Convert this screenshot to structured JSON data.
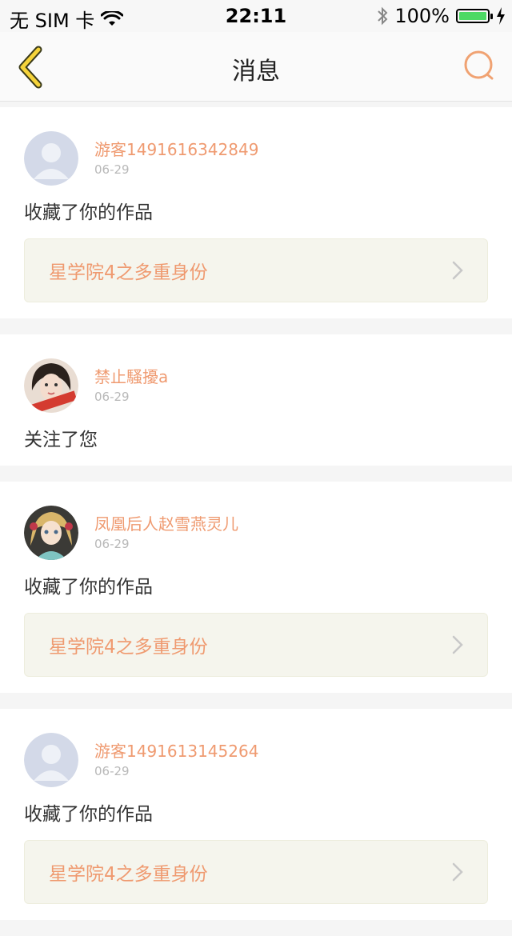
{
  "status_bar": {
    "carrier": "无 SIM 卡",
    "time": "22:11",
    "battery": "100%",
    "icons": [
      "wifi-icon",
      "bluetooth-icon",
      "battery-icon",
      "charging-icon"
    ]
  },
  "nav": {
    "title": "消息",
    "back_icon": "back-chevron-icon",
    "search_icon": "search-icon",
    "accent_color": "#f0a272",
    "back_color": "#f5d33a"
  },
  "messages": [
    {
      "username": "游客1491616342849",
      "date": "06-29",
      "action": "收藏了你的作品",
      "work_title": "星学院4之多重身份",
      "avatar": "default-avatar-icon"
    },
    {
      "username": "禁止騷擾a",
      "date": "06-29",
      "action": "关注了您",
      "avatar": "user-photo-avatar"
    },
    {
      "username": "凤凰后人赵雪燕灵儿",
      "date": "06-29",
      "action": "收藏了你的作品",
      "work_title": "星学院4之多重身份",
      "avatar": "anime-avatar"
    },
    {
      "username": "游客1491613145264",
      "date": "06-29",
      "action": "收藏了你的作品",
      "work_title": "星学院4之多重身份",
      "avatar": "default-avatar-icon"
    }
  ],
  "colors": {
    "username": "#ef9a70",
    "date": "#b8b8b8",
    "work_box_bg": "#f5f5ed"
  }
}
